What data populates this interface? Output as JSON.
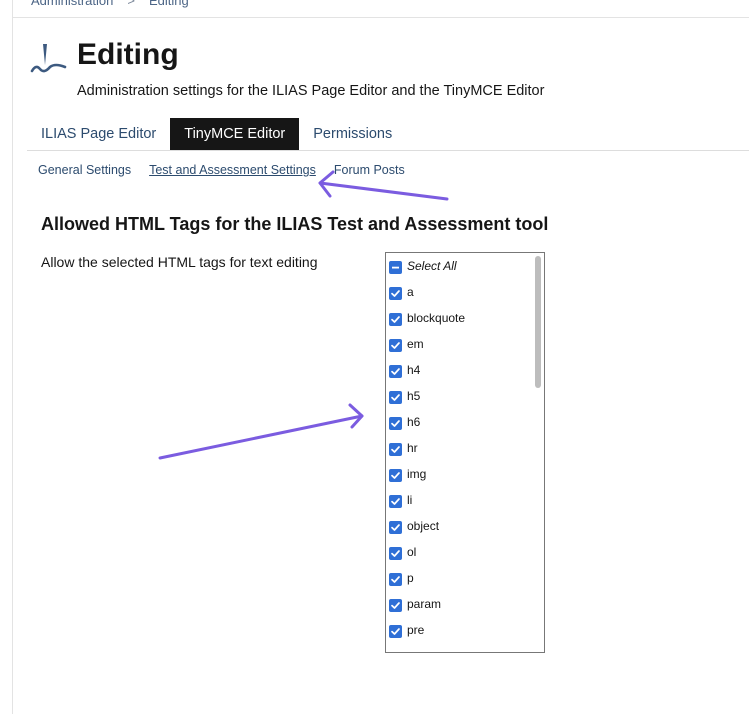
{
  "breadcrumb": {
    "items": [
      "Administration",
      "Editing"
    ],
    "separator": ">"
  },
  "header": {
    "title": "Editing",
    "description": "Administration settings for the ILIAS Page Editor and the TinyMCE Editor"
  },
  "tabs": [
    {
      "label": "ILIAS Page Editor",
      "active": false
    },
    {
      "label": "TinyMCE Editor",
      "active": true
    },
    {
      "label": "Permissions",
      "active": false
    }
  ],
  "subtabs": [
    {
      "label": "General Settings",
      "active": false
    },
    {
      "label": "Test and Assessment Settings",
      "active": true
    },
    {
      "label": "Forum Posts",
      "active": false
    }
  ],
  "section": {
    "title": "Allowed HTML Tags for the ILIAS Test and Assessment tool",
    "field_label": "Allow the selected HTML tags for text editing"
  },
  "tag_list": {
    "select_all": {
      "label": "Select All",
      "state": "indeterminate"
    },
    "options": [
      {
        "label": "a",
        "checked": true
      },
      {
        "label": "blockquote",
        "checked": true
      },
      {
        "label": "em",
        "checked": true
      },
      {
        "label": "h4",
        "checked": true
      },
      {
        "label": "h5",
        "checked": true
      },
      {
        "label": "h6",
        "checked": true
      },
      {
        "label": "hr",
        "checked": true
      },
      {
        "label": "img",
        "checked": true
      },
      {
        "label": "li",
        "checked": true
      },
      {
        "label": "object",
        "checked": true
      },
      {
        "label": "ol",
        "checked": true
      },
      {
        "label": "p",
        "checked": true
      },
      {
        "label": "param",
        "checked": true
      },
      {
        "label": "pre",
        "checked": true
      }
    ]
  },
  "colors": {
    "accent": "#2f6fd6",
    "active_tab": "#161616",
    "link": "#2c4b6e",
    "annotation_arrow": "#7b5ce0"
  }
}
